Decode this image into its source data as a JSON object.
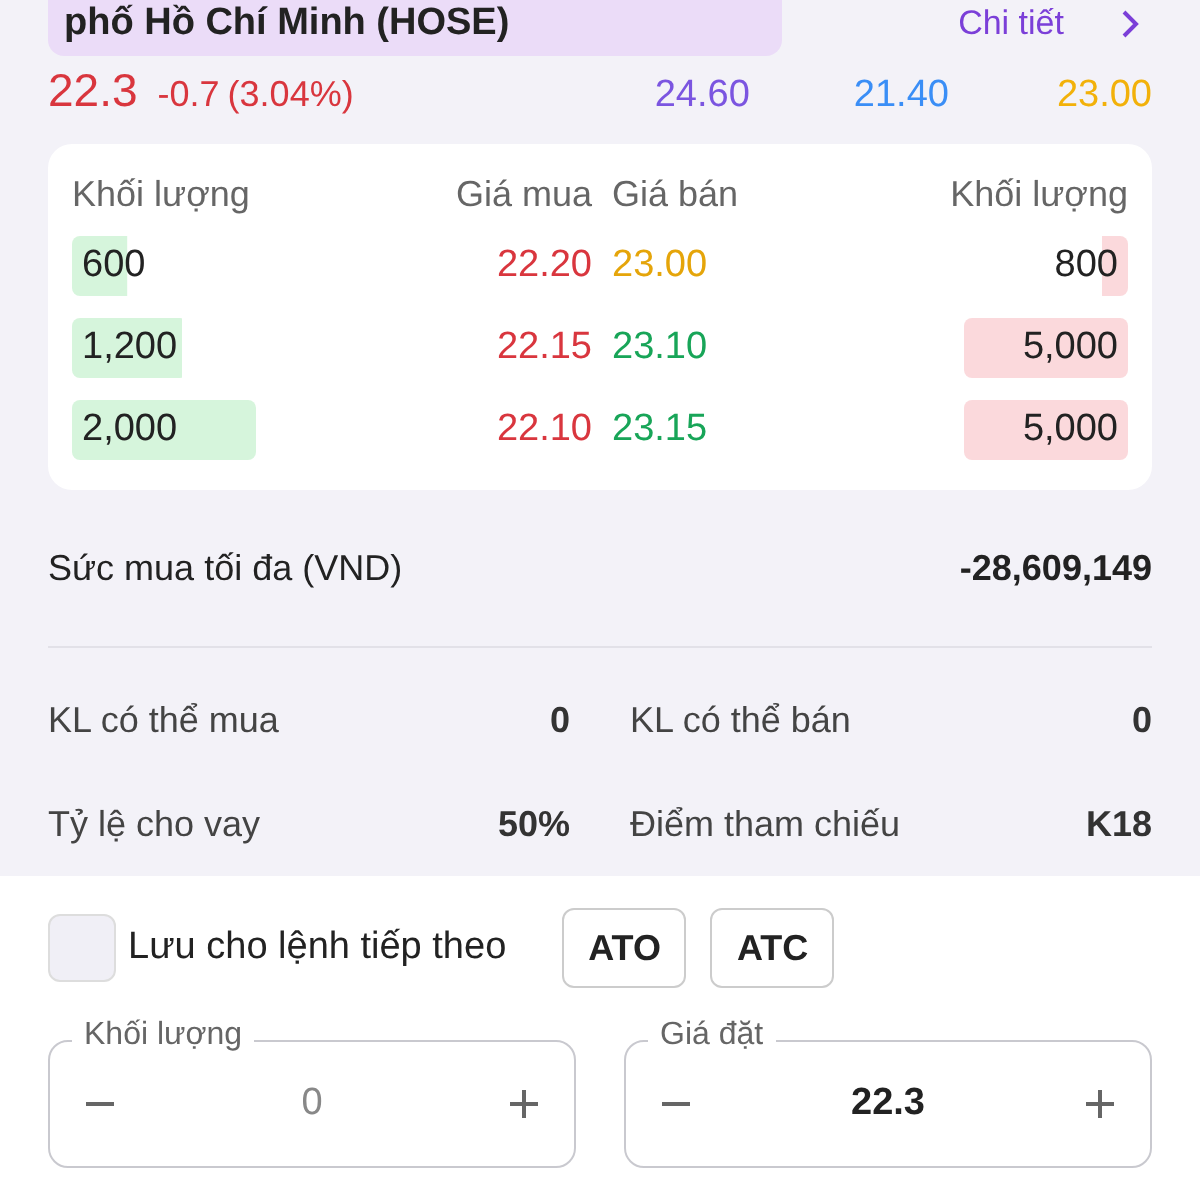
{
  "exchange_label": "phố Hồ Chí Minh (HOSE)",
  "detail_link": "Chi tiết",
  "price": {
    "last": "22.3",
    "change": "-0.7",
    "percent": "(3.04%)",
    "ceiling": "24.60",
    "floor": "21.40",
    "reference": "23.00"
  },
  "order_book": {
    "columns": [
      "Khối lượng",
      "Giá mua",
      "Giá bán",
      "Khối lượng"
    ],
    "rows": [
      {
        "bid_volume": "600",
        "bid_price": "22.20",
        "ask_price": {
          "value": "23.00",
          "color": "#e5a50a"
        },
        "ask_volume": "800"
      },
      {
        "bid_volume": "1,200",
        "bid_price": "22.15",
        "ask_price": {
          "value": "23.10",
          "color": "#18a558"
        },
        "ask_volume": "5,000"
      },
      {
        "bid_volume": "2,000",
        "bid_price": "22.10",
        "ask_price": {
          "value": "23.15",
          "color": "#18a558"
        },
        "ask_volume": "5,000"
      }
    ]
  },
  "buying_power": {
    "label": "Sức mua tối đa (VND)",
    "value": "-28,609,149"
  },
  "stats": [
    {
      "label": "KL có thể mua",
      "value": "0"
    },
    {
      "label": "KL có thể bán",
      "value": "0"
    },
    {
      "label": "Tỷ lệ cho vay",
      "value": "50%"
    },
    {
      "label": "Điểm tham chiếu",
      "value": "K18"
    }
  ],
  "save_checkbox": {
    "label": "Lưu cho lệnh tiếp theo",
    "checked": false
  },
  "session_buttons": [
    "ATO",
    "ATC"
  ],
  "inputs": [
    {
      "label": "Khối lượng",
      "value": "0",
      "filled": false
    },
    {
      "label": "Giá đặt",
      "value": "22.3",
      "filled": true
    }
  ]
}
